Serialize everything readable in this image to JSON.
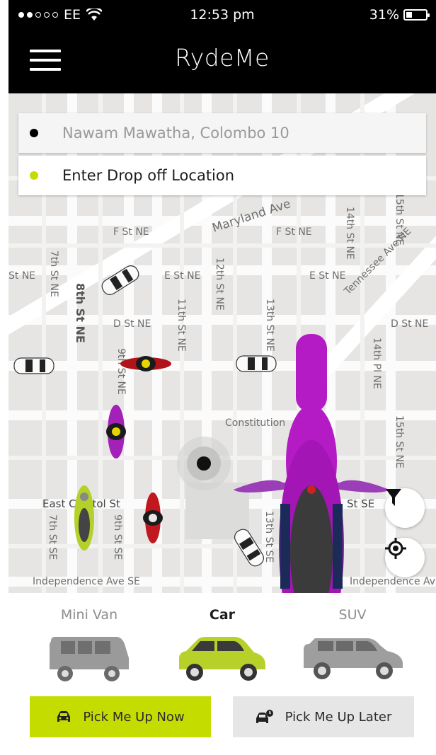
{
  "status_bar": {
    "carrier": "EE",
    "time": "12:53 pm",
    "battery": "31%",
    "battery_level": 0.31
  },
  "header": {
    "title": "RydeMe"
  },
  "trip": {
    "pickup_label": "Nawam Mawatha, Colombo 10",
    "dropoff_placeholder": "Enter Drop off Location"
  },
  "map": {
    "street_labels": [
      "F St NE",
      "F St NE",
      "E St NE",
      "E St NE",
      "St NE",
      "D St NE",
      "D St NE",
      "Maryland Ave",
      "Tennessee Ave NE",
      "8th St NE",
      "7th St NE",
      "11th St NE",
      "12th St NE",
      "13th St NE",
      "14th St NE",
      "14th Pl NE",
      "15th St NE",
      "9th St NE",
      "Constitution",
      "East Capitol St",
      "St SE",
      "7th St SE",
      "9th St SE",
      "13th St SE",
      "Independence Ave SE",
      "Independence Av",
      "15th St NE"
    ]
  },
  "vehicle_types": [
    {
      "label": "Mini Van",
      "active": false
    },
    {
      "label": "Car",
      "active": true
    },
    {
      "label": "SUV",
      "active": false
    }
  ],
  "actions": {
    "now_label": "Pick Me Up Now",
    "later_label": "Pick Me Up Later"
  },
  "colors": {
    "accent": "#c4dc00",
    "header_bg": "#000000",
    "map_bg": "#e6e5e3"
  },
  "icons": [
    "menu-icon",
    "filter-icon",
    "gps-target-icon",
    "car-icon",
    "car-clock-icon",
    "wifi-icon",
    "battery-icon"
  ]
}
